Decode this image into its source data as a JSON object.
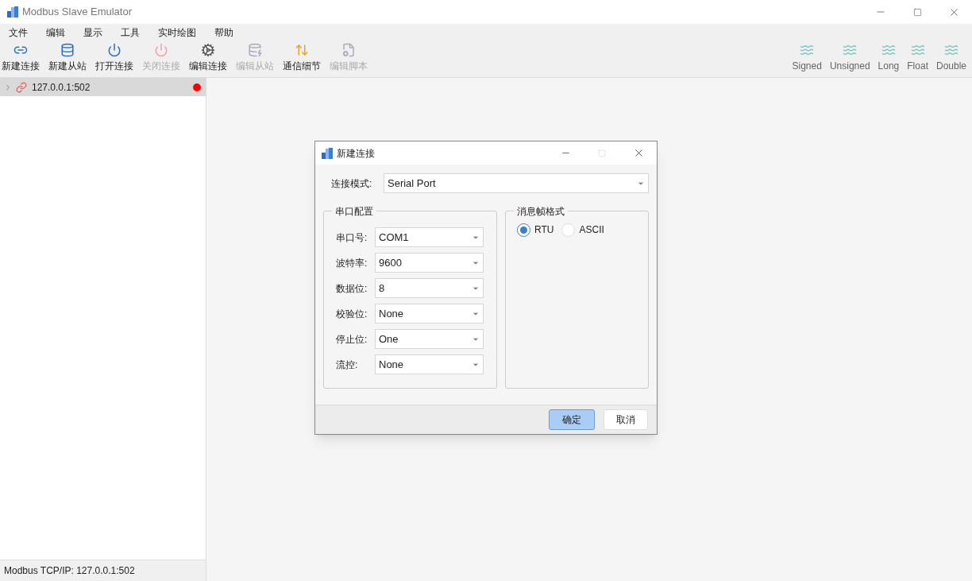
{
  "window": {
    "title": "Modbus Slave Emulator"
  },
  "menu": [
    "文件",
    "编辑",
    "显示",
    "工具",
    "实时绘图",
    "帮助"
  ],
  "toolbar": [
    {
      "label": "新建连接",
      "disabled": false
    },
    {
      "label": "新建从站",
      "disabled": false
    },
    {
      "label": "打开连接",
      "disabled": false
    },
    {
      "label": "关闭连接",
      "disabled": true
    },
    {
      "label": "编辑连接",
      "disabled": false
    },
    {
      "label": "编辑从站",
      "disabled": true
    },
    {
      "label": "通信细节",
      "disabled": false
    },
    {
      "label": "编辑脚本",
      "disabled": true
    }
  ],
  "format_toolbar": [
    "Signed",
    "Unsigned",
    "Long",
    "Float",
    "Double"
  ],
  "tree": [
    {
      "label": "127.0.0.1:502",
      "expanded": false,
      "selected": true,
      "color": "#ff0000"
    }
  ],
  "status_bar": "Modbus TCP/IP: 127.0.0.1:502",
  "dialog": {
    "title": "新建连接",
    "mode": {
      "label": "连接模式:",
      "value": "Serial Port"
    },
    "serial_group": {
      "title": "串口配置",
      "fields": [
        {
          "label": "串口号:",
          "value": "COM1"
        },
        {
          "label": "波特率:",
          "value": "9600"
        },
        {
          "label": "数据位:",
          "value": "8"
        },
        {
          "label": "校验位:",
          "value": "None"
        },
        {
          "label": "停止位:",
          "value": "One"
        },
        {
          "label": "流控:",
          "value": "None"
        }
      ]
    },
    "frame_group": {
      "title": "消息帧格式",
      "options": [
        {
          "label": "RTU",
          "selected": true
        },
        {
          "label": "ASCII",
          "selected": false
        }
      ]
    },
    "buttons": [
      {
        "label": "确定",
        "default": true
      },
      {
        "label": "取消",
        "default": false
      }
    ]
  }
}
